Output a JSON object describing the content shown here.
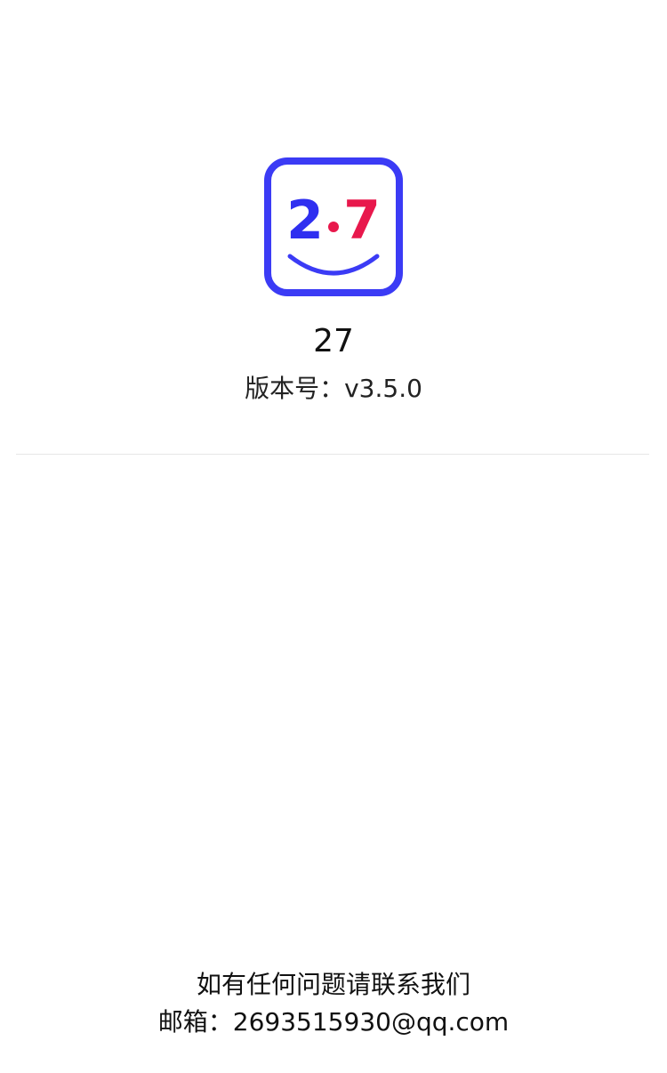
{
  "app": {
    "logo": {
      "icon": "smiley-27-logo-icon",
      "left_digit": "2",
      "right_digit": "7",
      "frame_color": "#3b3bf5",
      "left_digit_color": "#2f2ff0",
      "dot_color": "#e8184c",
      "right_digit_color": "#e8184c",
      "smile_color": "#3b3bf5"
    },
    "name": "27",
    "version_label": "版本号：",
    "version_value": "v3.5.0"
  },
  "footer": {
    "contact_text": "如有任何问题请联系我们",
    "email_label": "邮箱：",
    "email_value": "2693515930@qq.com"
  }
}
